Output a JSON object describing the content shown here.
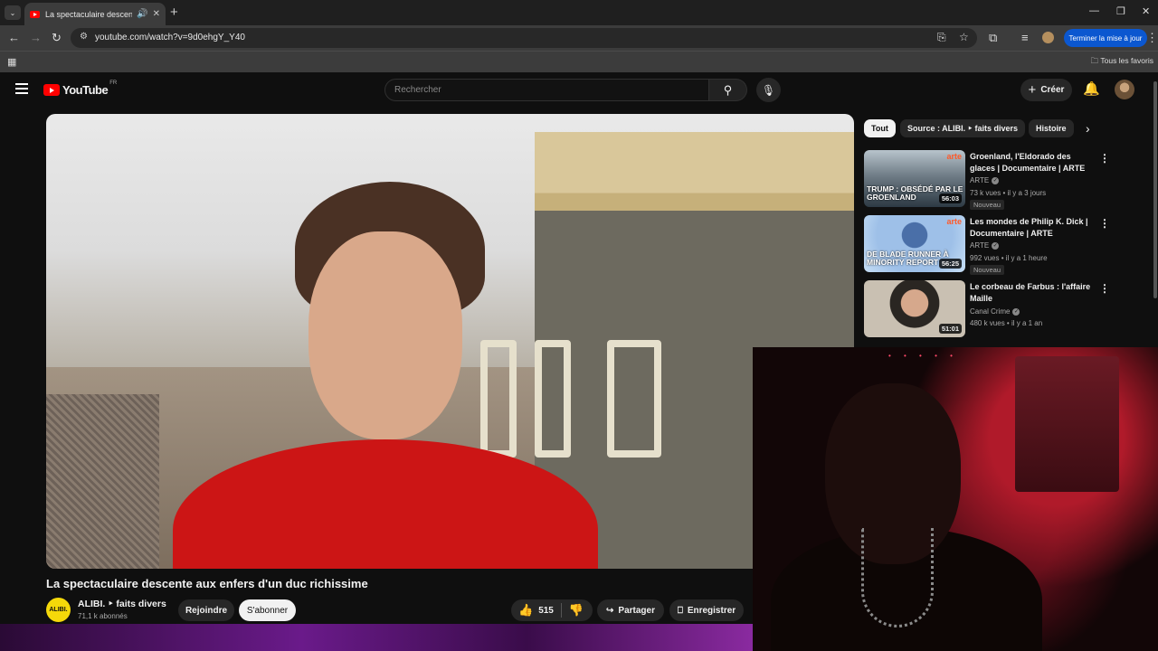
{
  "browser": {
    "tab_title": "La spectaculaire descente a",
    "url": "youtube.com/watch?v=9d0ehgY_Y40",
    "update_button": "Terminer la mise à jour",
    "bookmarks_all": "Tous les favoris"
  },
  "header": {
    "logo_text": "YouTube",
    "region": "FR",
    "search_placeholder": "Rechercher",
    "create_label": "Créer"
  },
  "video": {
    "title": "La spectaculaire descente aux enfers d'un duc richissime",
    "channel_avatar_text": "ALIBI.",
    "channel_name": "ALIBI. ‣ faits divers",
    "subscribers": "71,1 k abonnés",
    "join_label": "Rejoindre",
    "subscribe_label": "S'abonner",
    "like_count": "515",
    "share_label": "Partager",
    "save_label": "Enregistrer"
  },
  "chips": [
    {
      "label": "Tout",
      "active": true
    },
    {
      "label": "Source : ALIBI. ‣ faits divers",
      "active": false
    },
    {
      "label": "Histoire",
      "active": false
    }
  ],
  "recommendations": [
    {
      "title": "Groenland, l'Eldorado des glaces | Documentaire | ARTE",
      "channel": "ARTE",
      "meta": "73 k vues • il y a 3 jours",
      "badge": "Nouveau",
      "duration": "56:03",
      "thumb_brand": "arte",
      "thumb_text": "TRUMP : OBSÉDÉ PAR LE GROENLAND"
    },
    {
      "title": "Les mondes de Philip K. Dick | Documentaire | ARTE",
      "channel": "ARTE",
      "meta": "992 vues • il y a 1 heure",
      "badge": "Nouveau",
      "duration": "56:25",
      "thumb_brand": "arte",
      "thumb_text": "DE BLADE RUNNER À MINORITY REPORT"
    },
    {
      "title": "Le corbeau de Farbus : l'affaire Maille",
      "channel": "Canal Crime",
      "meta": "480 k vues • il y a 1 an",
      "duration": "51:01"
    }
  ],
  "colors": {
    "youtube_red": "#ff0000",
    "background": "#0f0f0f",
    "chrome_blue": "#0b57d0"
  }
}
